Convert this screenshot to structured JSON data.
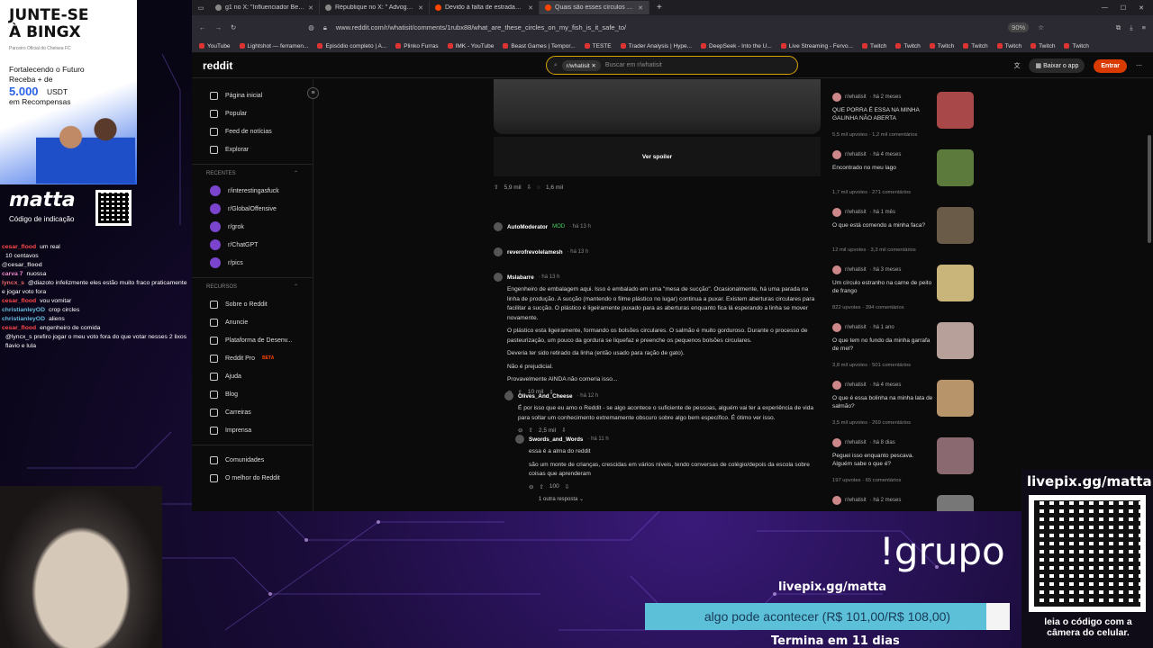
{
  "browser": {
    "tabs": [
      {
        "label": "g1 no X: \"Influenciador Ben Me\"",
        "color": "#888"
      },
      {
        "label": "République no X: \" Advogad\"",
        "color": "#888"
      },
      {
        "label": "Devido à falta de estradas trans",
        "color": "#ff4500"
      },
      {
        "label": "Quais são esses círculos no me",
        "color": "#ff4500",
        "active": true
      }
    ],
    "new_tab": "+",
    "url": "www.reddit.com/r/whatisit/comments/1rubx88/what_are_these_circles_on_my_fish_is_it_safe_to/",
    "zoom": "90%",
    "bookmarks": [
      "YouTube",
      "Lightshot — ferramen...",
      "Episódio completo | A...",
      "Plinko Furras",
      "IMK - YouTube",
      "Beast Games | Tempor...",
      "TESTE",
      "Trader Analysis | Hype...",
      "DeepSeek - Into the U...",
      "Live Streaming - Fervo...",
      "Twitch",
      "Twitch",
      "Twitch",
      "Twitch",
      "Twitch",
      "Twitch",
      "Twitch"
    ]
  },
  "reddit": {
    "logo": "reddit",
    "search_chip": "r/whatisit",
    "search_placeholder": "Buscar em r/whatisit",
    "get_app": "Baixar o app",
    "login": "Entrar"
  },
  "sidebar": {
    "nav": [
      "Página inicial",
      "Popular",
      "Feed de notícias",
      "Explorar"
    ],
    "recent_label": "RECENTES",
    "recent": [
      "r/interestingasfuck",
      "r/GlobalOffensive",
      "r/grok",
      "r/ChatGPT",
      "r/pics"
    ],
    "resources_label": "RECURSOS",
    "resources": [
      "Sobre o Reddit",
      "Anuncie",
      "Plataforma de Desenv...",
      "Reddit Pro",
      "Ajuda",
      "Blog",
      "Carreiras",
      "Imprensa"
    ],
    "beta": "BETA",
    "bottom": [
      "Comunidades",
      "O melhor do Reddit"
    ]
  },
  "post": {
    "spoiler": "Ver spoiler",
    "upvotes": "5,9 mil",
    "comments": "1,6 mil"
  },
  "comments": [
    {
      "user": "AutoModerator",
      "badge": "MOD",
      "time": "· há 13 h"
    },
    {
      "user": "reverofrevolelamesh",
      "time": "· há 13 h"
    },
    {
      "user": "Mslabarre",
      "time": "· há 13 h",
      "paragraphs": [
        "Engenheiro de embalagem aqui. Isso é embalado em uma \"mesa de sucção\". Ocasionalmente, há uma parada na linha de produção. A sucção (mantendo o filme plástico no lugar) continua a puxar. Existem aberturas circulares para facilitar a sucção. O plástico é ligeiramente puxado para as aberturas enquanto fica lá esperando a linha se mover novamente.",
        "O plástico esta ligeiramente, formando os bolsões circulares. O salmão é muito gorduroso. Durante o processo de pasteurização, um pouco da gordura se liquefaz e preenche os pequenos bolsões circulares.",
        "Deveria ter sido retirado da linha (então usado para ração de gato).",
        "Não é prejudicial.",
        "Provavelmente AINDA não comeria isso..."
      ],
      "votes": "10 mil"
    },
    {
      "user": "Olives_And_Cheese",
      "time": "· há 12 h",
      "paragraphs": [
        "É por isso que eu amo o Reddit - se algo acontece o suficiente de pessoas, alguém vai ter a experiência de vida para soltar um conhecimento extremamente obscuro sobre algo bem específico. É ótimo ver isso."
      ],
      "votes": "2,5 mil"
    },
    {
      "user": "Swords_and_Words",
      "time": "· há 11 h",
      "paragraphs": [
        "essa é a alma do reddit",
        "são um monte de crianças, crescidas em vários níveis, tendo conversas de colégio/depois da escola sobre coisas que aprenderam"
      ],
      "votes": "100"
    }
  ],
  "more_replies": "1 outra resposta",
  "related": [
    {
      "sub": "r/whatisit",
      "time": "· há 2 meses",
      "title": "QUE PORRA É ESSA NA MINHA GALINHA NÃO ABERTA",
      "meta": "5,5 mil upvotes · 1,2 mil comentários",
      "thumb": "#a84848"
    },
    {
      "sub": "r/whatisit",
      "time": "· há 4 meses",
      "title": "Encontrado no meu lago",
      "meta": "1,7 mil upvotes · 271 comentários",
      "thumb": "#5c7a3c"
    },
    {
      "sub": "r/whatisit",
      "time": "· há 1 mês",
      "title": "O que está comendo a minha faca?",
      "meta": "12 mil upvotes · 3,3 mil comentários",
      "thumb": "#6a5a48"
    },
    {
      "sub": "r/whatisit",
      "time": "· há 3 meses",
      "title": "Um círculo estranho na carne de peito de frango",
      "meta": "822 upvotes · 394 comentários",
      "thumb": "#c9b47a"
    },
    {
      "sub": "r/whatisit",
      "time": "· há 1 ano",
      "title": "O que tem no fundo da minha garrafa de mel?",
      "meta": "3,8 mil upvotes · 501 comentários",
      "thumb": "#b8a09a"
    },
    {
      "sub": "r/whatisit",
      "time": "· há 4 meses",
      "title": "O que é essa bolinha na minha lata de salmão?",
      "meta": "3,5 mil upvotes · 269 comentários",
      "thumb": "#b8946a"
    },
    {
      "sub": "r/whatisit",
      "time": "· há 8 dias",
      "title": "Peguei isso enquanto pescava. Alguém sabe o que é?",
      "meta": "197 upvotes · 65 comentários",
      "thumb": "#8a6a70"
    },
    {
      "sub": "r/whatisit",
      "time": "· há 2 meses",
      "title": "",
      "meta": "",
      "thumb": "#777"
    }
  ],
  "overlay": {
    "ad_title": "JUNTE-SE À BINGX",
    "ad_sub": "Parceiro Oficial do Chelsea FC",
    "ad_line1": "Fortalecendo o Futuro",
    "ad_line2": "Receba + de",
    "ad_amount": "5.000",
    "ad_currency": "USDT",
    "ad_line3": "em Recompensas",
    "brand": "matta",
    "brand_sub": "Código de indicação",
    "livepix_top": "livepix.gg/matta",
    "grupo": "!grupo",
    "livepix_mid": "livepix.gg/matta",
    "goal": "algo pode acontecer (R$ 101,00/R$ 108,00)",
    "goal_fraction": 0.935,
    "ends": "Termina em 11 dias",
    "qr_caption": "leia o código com a câmera do celular."
  },
  "chat": [
    {
      "user": "cesar_flood",
      "msg": "um real",
      "color": "#ff4a4a"
    },
    {
      "user": "",
      "msg": "10 centavos",
      "color": "#7ad"
    },
    {
      "user": "@cesar_flood",
      "msg": "",
      "color": "#ccc"
    },
    {
      "user": "carva 7",
      "msg": "nuossa",
      "color": "#e8c"
    },
    {
      "user": "lyncx_s",
      "msg": "@diazoto infelizmente eles estão muito fraco praticamente e jogar voto fora",
      "color": "#e66"
    },
    {
      "user": "cesar_flood",
      "msg": "vou vomitar",
      "color": "#ff4a4a"
    },
    {
      "user": "christianleyOD",
      "msg": "crop circles",
      "color": "#6bd"
    },
    {
      "user": "christianleyOD",
      "msg": "aliens",
      "color": "#6bd"
    },
    {
      "user": "cesar_flood",
      "msg": "engenheiro de comida",
      "color": "#ff4a4a"
    },
    {
      "user": "",
      "msg": "@lyncx_s prefiro jogar o meu voto fora do que votar nesses 2 lixos",
      "color": "#ccc"
    },
    {
      "user": "",
      "msg": "flavio e lula",
      "color": "#ccc"
    }
  ]
}
